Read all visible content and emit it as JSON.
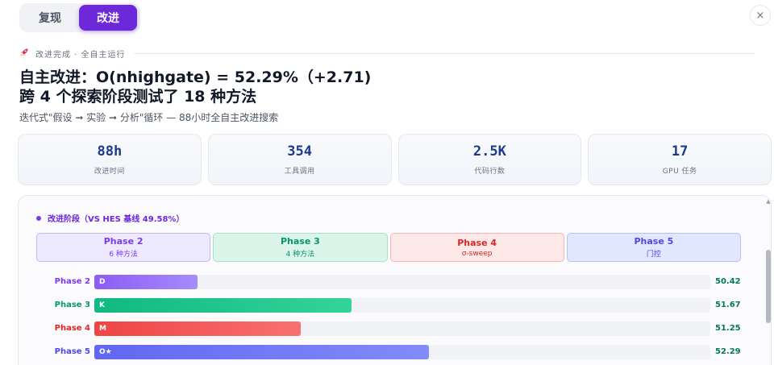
{
  "tabs": [
    {
      "label": "复现",
      "active": false
    },
    {
      "label": "改进",
      "active": true
    }
  ],
  "close_label": "×",
  "status": {
    "icon": "rocket-icon",
    "text": "改进完成 · 全自主运行"
  },
  "title_line1": "自主改进：O(nhighgate) = 52.29%（+2.71)",
  "title_line2": "跨 4 个探索阶段测试了 18 种方法",
  "subtitle": "迭代式\"假设 ➞ 实验 ➞ 分析\"循环 — 88小时全自主改进搜索",
  "stats": [
    {
      "value": "88h",
      "label": "改进时间"
    },
    {
      "value": "354",
      "label": "工具调用"
    },
    {
      "value": "2.5K",
      "label": "代码行数"
    },
    {
      "value": "17",
      "label": "GPU 任务"
    }
  ],
  "panel": {
    "title": "改进阶段（VS HES 基线 49.58%）",
    "phases": [
      {
        "name": "Phase 2",
        "sub": "6 种方法",
        "color": "purple"
      },
      {
        "name": "Phase 3",
        "sub": "4 种方法",
        "color": "green"
      },
      {
        "name": "Phase 4",
        "sub": "σ-sweep",
        "color": "red"
      },
      {
        "name": "Phase 5",
        "sub": "门控",
        "color": "indigo"
      }
    ],
    "rows": [
      {
        "label": "Phase 2",
        "code": "D",
        "value": "50.42",
        "fill": 0.167,
        "label_color": "#7c3aed",
        "bar_gradient": [
          "#8b5cf6",
          "#a78bfa"
        ]
      },
      {
        "label": "Phase 3",
        "code": "K",
        "value": "51.67",
        "fill": 0.418,
        "label_color": "#059669",
        "bar_gradient": [
          "#10b981",
          "#34d399"
        ]
      },
      {
        "label": "Phase 4",
        "code": "M",
        "value": "51.25",
        "fill": 0.335,
        "label_color": "#dc2626",
        "bar_gradient": [
          "#ef4444",
          "#f87171"
        ]
      },
      {
        "label": "Phase 5",
        "code": "O★",
        "value": "52.29",
        "fill": 0.543,
        "label_color": "#4f46e5",
        "bar_gradient": [
          "#6366f1",
          "#818cf8"
        ]
      }
    ]
  }
}
